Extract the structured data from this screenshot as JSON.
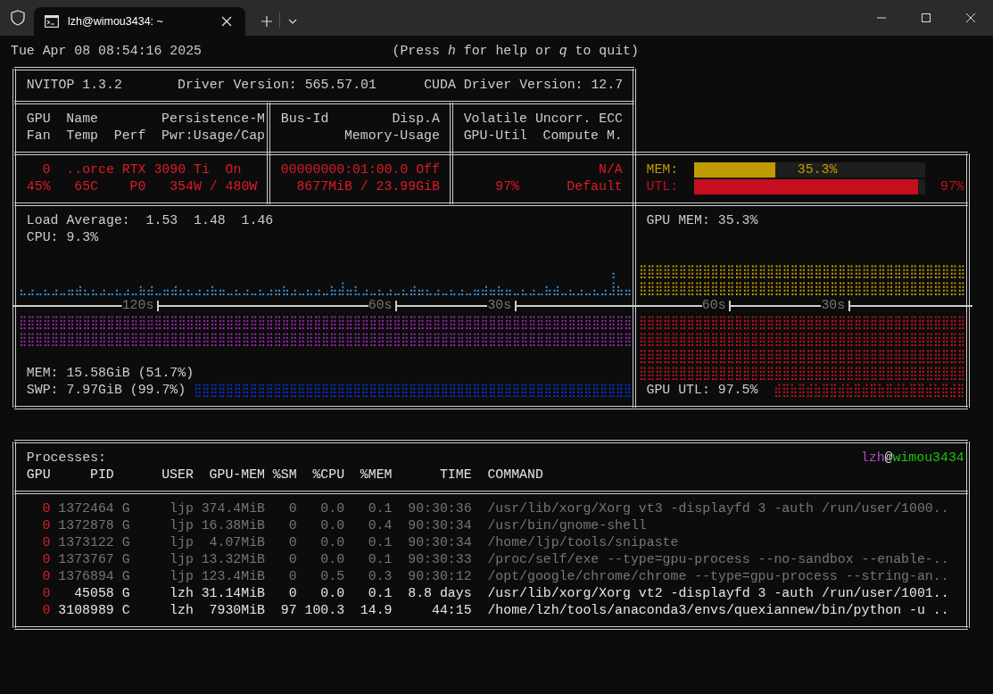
{
  "tabs": [
    {
      "title": "lzh@wimou3434: ~",
      "selected": true
    }
  ],
  "header": {
    "datetime": "Tue Apr 08 08:54:16 2025",
    "help": "(Press *h* for help or *q* to quit)"
  },
  "gpu_panel": {
    "version": "NVITOP 1.3.2",
    "driver": "Driver Version: 565.57.01",
    "cuda": "CUDA Driver Version: 12.7",
    "headers": [
      "GPU",
      "Name",
      "Persistence-M",
      "Bus-Id",
      "Disp.A",
      "Volatile Uncorr. ECC",
      "Fan",
      "Temp",
      "Perf",
      "Pwr:Usage/Cap",
      "Memory-Usage",
      "GPU-Util",
      "Compute M."
    ],
    "values": [
      "0",
      "..orce RTX 3090 Ti",
      "On",
      "00000000:01:00.0",
      "Off",
      "N/A",
      "45%",
      "65C",
      "P0",
      "354W / 480W",
      "8677MiB / 23.99GiB",
      "97%",
      "Default"
    ]
  },
  "bars": [
    {
      "label": "MEM:",
      "level": 0.353,
      "reading": "35.3%",
      "color": "#c19c00"
    },
    {
      "label": "UTL:",
      "level": 0.97,
      "reading": "97%",
      "color": "#c50f1f"
    }
  ],
  "host": {
    "load": "Load Average:  1.53  1.48  1.46",
    "cpu": "CPU: 9.3%",
    "mem": "MEM: 15.58GiB (51.7%)",
    "swap": "SWP: 7.97GiB (99.7%)",
    "axis_labels": [
      "120s",
      "60s",
      "30s"
    ]
  },
  "gpu_history": {
    "mem": "GPU MEM: 35.3%",
    "util": "GPU UTL: 97.5%",
    "axis_labels": [
      "60s",
      "30s"
    ]
  },
  "processes": {
    "title": "Processes:",
    "user": "lzh",
    "at": "@",
    "host": "wimou3434",
    "columns": [
      "GPU",
      "PID",
      "USER",
      "GPU-MEM",
      "%SM",
      "%CPU",
      "%MEM",
      "TIME",
      "COMMAND"
    ],
    "rows": [
      {
        "gpu": "0",
        "pid": "1372464",
        "type": "G",
        "user": "ljp",
        "gpu_mem": "374.4MiB",
        "sm": "0",
        "cpu": "0.0",
        "mem": "0.1",
        "time": "90:30:36",
        "command": "/usr/lib/xorg/Xorg vt3 -displayfd 3 -auth /run/user/1000..",
        "dimmed": true
      },
      {
        "gpu": "0",
        "pid": "1372878",
        "type": "G",
        "user": "ljp",
        "gpu_mem": "16.38MiB",
        "sm": "0",
        "cpu": "0.0",
        "mem": "0.4",
        "time": "90:30:34",
        "command": "/usr/bin/gnome-shell",
        "dimmed": true
      },
      {
        "gpu": "0",
        "pid": "1373122",
        "type": "G",
        "user": "ljp",
        "gpu_mem": "4.07MiB",
        "sm": "0",
        "cpu": "0.0",
        "mem": "0.1",
        "time": "90:30:34",
        "command": "/home/ljp/tools/snipaste",
        "dimmed": true
      },
      {
        "gpu": "0",
        "pid": "1373767",
        "type": "G",
        "user": "ljp",
        "gpu_mem": "13.32MiB",
        "sm": "0",
        "cpu": "0.0",
        "mem": "0.1",
        "time": "90:30:33",
        "command": "/proc/self/exe --type=gpu-process --no-sandbox --enable-..",
        "dimmed": true
      },
      {
        "gpu": "0",
        "pid": "1376894",
        "type": "G",
        "user": "ljp",
        "gpu_mem": "123.4MiB",
        "sm": "0",
        "cpu": "0.5",
        "mem": "0.3",
        "time": "90:30:12",
        "command": "/opt/google/chrome/chrome --type=gpu-process --string-an..",
        "dimmed": true
      },
      {
        "gpu": "0",
        "pid": "45058",
        "type": "G",
        "user": "lzh",
        "gpu_mem": "31.14MiB",
        "sm": "0",
        "cpu": "0.0",
        "mem": "0.1",
        "time": "8.8 days",
        "command": "/usr/lib/xorg/Xorg vt2 -displayfd 3 -auth /run/user/1001..",
        "dimmed": false
      },
      {
        "gpu": "0",
        "pid": "3108989",
        "type": "C",
        "user": "lzh",
        "gpu_mem": "7930MiB",
        "sm": "97",
        "cpu": "100.3",
        "mem": "14.9",
        "time": "44:15",
        "command": "/home/lzh/tools/anaconda3/envs/quexiannew/bin/python -u ..",
        "dimmed": false
      }
    ]
  }
}
